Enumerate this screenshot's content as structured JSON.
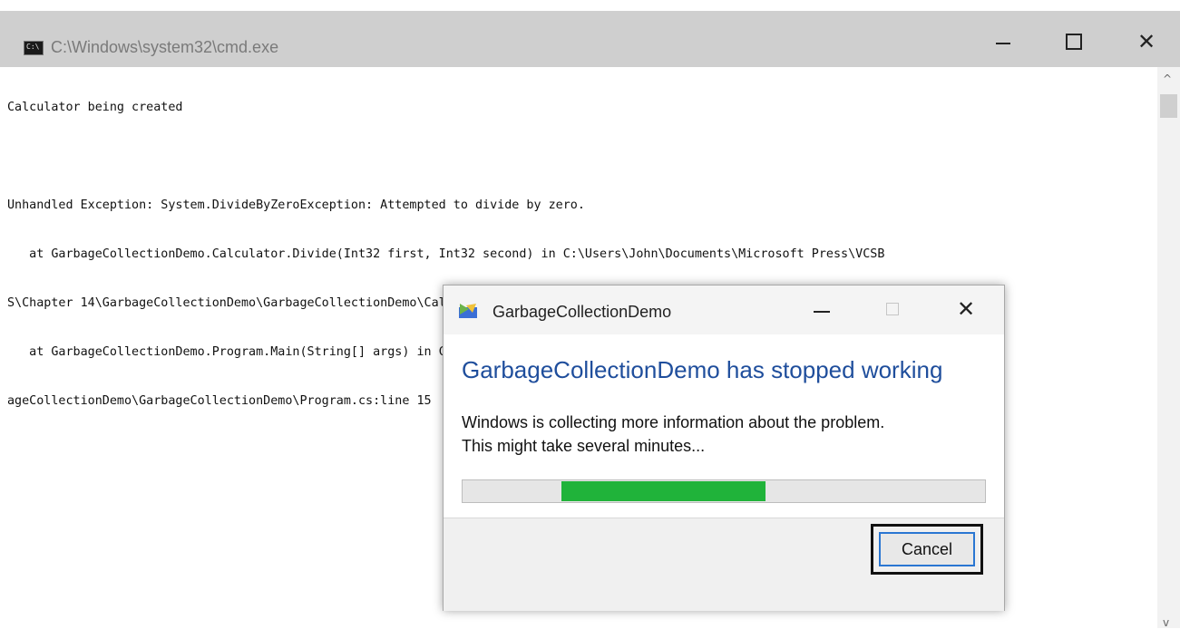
{
  "window": {
    "title": "C:\\Windows\\system32\\cmd.exe",
    "icon": "console-icon",
    "icon_text": "C:\\",
    "controls": {
      "minimize_icon": "minimize-icon",
      "maximize_icon": "maximize-icon",
      "close_icon": "close-icon",
      "close_glyph": "✕"
    }
  },
  "console": {
    "lines": [
      "Calculator being created",
      "",
      "Unhandled Exception: System.DivideByZeroException: Attempted to divide by zero.",
      "   at GarbageCollectionDemo.Calculator.Divide(Int32 first, Int32 second) in C:\\Users\\John\\Documents\\Microsoft Press\\VCSB",
      "S\\Chapter 14\\GarbageCollectionDemo\\GarbageCollectionDemo\\Calculator.cs:line 25",
      "   at GarbageCollectionDemo.Program.Main(String[] args) in C:\\Users\\John\\Documents\\Microsoft Press\\VCSBS\\Chapter 14\\Garb",
      "ageCollectionDemo\\GarbageCollectionDemo\\Program.cs:line 15"
    ]
  },
  "scrollbar": {
    "up_glyph": "^",
    "down_glyph": "v"
  },
  "dialog": {
    "title": "GarbageCollectionDemo",
    "heading": "GarbageCollectionDemo has stopped working",
    "message_line1": "Windows is collecting more information about the problem.",
    "message_line2": "This might take several minutes...",
    "progress": {
      "start_fraction": 0.19,
      "end_fraction": 0.58,
      "color": "#20b33a"
    },
    "cancel_label": "Cancel",
    "close_glyph": "✕"
  },
  "colors": {
    "heading": "#1f4e9c",
    "titlebar": "#cfcfcf",
    "focus_border": "#2a76d2"
  }
}
